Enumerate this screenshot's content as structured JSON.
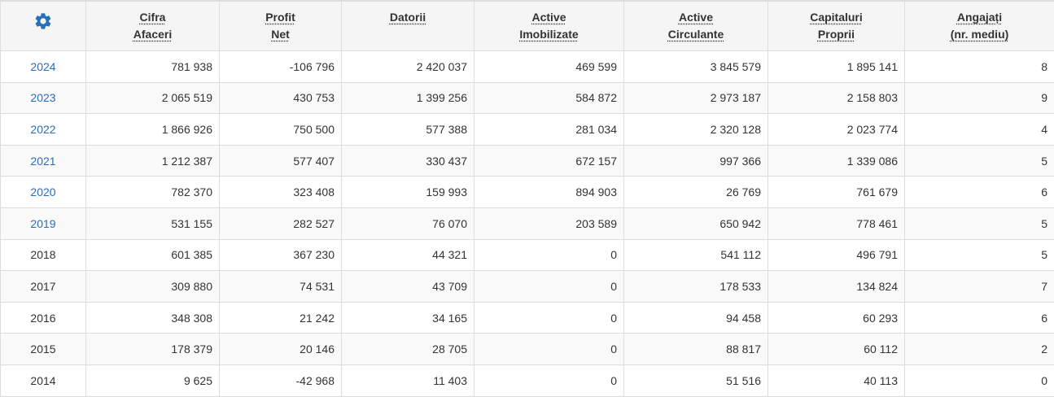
{
  "table": {
    "settings_icon": "gear-icon",
    "accent_color": "#2a6ebb",
    "columns": [
      {
        "key": "cifra",
        "lines": [
          "Cifra",
          "Afaceri"
        ]
      },
      {
        "key": "profit",
        "lines": [
          "Profit",
          "Net"
        ]
      },
      {
        "key": "datorii",
        "lines": [
          "Datorii"
        ]
      },
      {
        "key": "active_imob",
        "lines": [
          "Active",
          "Imobilizate"
        ]
      },
      {
        "key": "active_circ",
        "lines": [
          "Active",
          "Circulante"
        ]
      },
      {
        "key": "capitaluri",
        "lines": [
          "Capitaluri",
          "Proprii"
        ]
      },
      {
        "key": "angajati",
        "lines": [
          "Angajați",
          "(nr. mediu)"
        ]
      }
    ],
    "rows": [
      {
        "year": "2024",
        "link": true,
        "values": [
          "781 938",
          "-106 796",
          "2 420 037",
          "469 599",
          "3 845 579",
          "1 895 141",
          "8"
        ]
      },
      {
        "year": "2023",
        "link": true,
        "values": [
          "2 065 519",
          "430 753",
          "1 399 256",
          "584 872",
          "2 973 187",
          "2 158 803",
          "9"
        ]
      },
      {
        "year": "2022",
        "link": true,
        "values": [
          "1 866 926",
          "750 500",
          "577 388",
          "281 034",
          "2 320 128",
          "2 023 774",
          "4"
        ]
      },
      {
        "year": "2021",
        "link": true,
        "values": [
          "1 212 387",
          "577 407",
          "330 437",
          "672 157",
          "997 366",
          "1 339 086",
          "5"
        ]
      },
      {
        "year": "2020",
        "link": true,
        "values": [
          "782 370",
          "323 408",
          "159 993",
          "894 903",
          "26 769",
          "761 679",
          "6"
        ]
      },
      {
        "year": "2019",
        "link": true,
        "values": [
          "531 155",
          "282 527",
          "76 070",
          "203 589",
          "650 942",
          "778 461",
          "5"
        ]
      },
      {
        "year": "2018",
        "link": false,
        "values": [
          "601 385",
          "367 230",
          "44 321",
          "0",
          "541 112",
          "496 791",
          "5"
        ]
      },
      {
        "year": "2017",
        "link": false,
        "values": [
          "309 880",
          "74 531",
          "43 709",
          "0",
          "178 533",
          "134 824",
          "7"
        ]
      },
      {
        "year": "2016",
        "link": false,
        "values": [
          "348 308",
          "21 242",
          "34 165",
          "0",
          "94 458",
          "60 293",
          "6"
        ]
      },
      {
        "year": "2015",
        "link": false,
        "values": [
          "178 379",
          "20 146",
          "28 705",
          "0",
          "88 817",
          "60 112",
          "2"
        ]
      },
      {
        "year": "2014",
        "link": false,
        "values": [
          "9 625",
          "-42 968",
          "11 403",
          "0",
          "51 516",
          "40 113",
          "0"
        ]
      }
    ]
  }
}
